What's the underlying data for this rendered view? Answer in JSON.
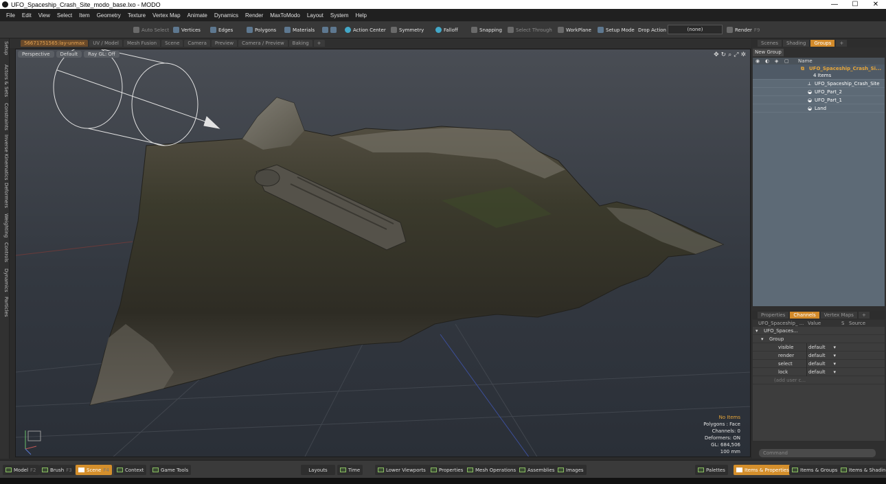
{
  "window": {
    "title": "UFO_Spaceship_Crash_Site_modo_base.lxo - MODO",
    "min": "—",
    "max": "☐",
    "close": "✕"
  },
  "menu": [
    "File",
    "Edit",
    "View",
    "Select",
    "Item",
    "Geometry",
    "Texture",
    "Vertex Map",
    "Animate",
    "Dynamics",
    "Render",
    "MaxToModo",
    "Layout",
    "System",
    "Help"
  ],
  "toolbar": {
    "auto_select": "Auto Select",
    "vertices": "Vertices",
    "edges": "Edges",
    "polygons": "Polygons",
    "materials": "Materials",
    "action_center": "Action Center",
    "symmetry": "Symmetry",
    "falloff": "Falloff",
    "snapping": "Snapping",
    "select_through": "Select Through",
    "workplane": "WorkPlane",
    "setup_mode": "Setup Mode",
    "drop_action": "Drop Action",
    "drop_value": "(none)",
    "render": "Render",
    "render_key": "F9"
  },
  "left_tabs": [
    "Setup",
    "Actors & Sets",
    "Constraints",
    "Inverse Kinematics",
    "Deformers",
    "Weighting",
    "Controls",
    "Dynamics",
    "Particles"
  ],
  "viewport_tabs": [
    "56671751565:lay-unmax",
    "UV / Model",
    "Mesh Fusion",
    "Scene",
    "Camera",
    "Preview",
    "Camera / Preview",
    "Baking",
    "+"
  ],
  "viewport": {
    "view": "Perspective",
    "shading": "Default",
    "raygl": "Ray GL: Off",
    "info": {
      "items": "No Items",
      "polygons": "Polygons : Face",
      "channels": "Channels: 0",
      "deformers": "Deformers: ON",
      "gl": "GL: 684,506",
      "scale": "100 mm"
    }
  },
  "scene_tabs": [
    "Scenes",
    "Shading",
    "Groups",
    "+"
  ],
  "groups": {
    "new_group": "New Group",
    "name_header": "Name",
    "root": {
      "name": "UFO_Spaceship_Crash_Si...",
      "count": "4 Items"
    },
    "children": [
      "UFO_Spaceship_Crash_Site",
      "UFO_Part_2",
      "UFO_Part_1",
      "Land"
    ]
  },
  "prop_tabs": [
    "Properties",
    "Channels",
    "Vertex Maps",
    "+"
  ],
  "channels": {
    "headers": {
      "name": "UFO_Spaceship_ ...",
      "value": "Value",
      "s": "S",
      "source": "Source"
    },
    "item": "UFO_Spaces...",
    "group": "Group",
    "rows": [
      {
        "name": "visible",
        "value": "default"
      },
      {
        "name": "render",
        "value": "default"
      },
      {
        "name": "select",
        "value": "default"
      },
      {
        "name": "lock",
        "value": "default"
      }
    ],
    "add_user": "(add user c..."
  },
  "command_placeholder": "Command",
  "bottom": {
    "model": "Model",
    "model_key": "F2",
    "brush": "Brush",
    "brush_key": "F3",
    "scene": "Scene",
    "scene_key": "F4",
    "context": "Context",
    "game_tools": "Game Tools",
    "layouts": "Layouts",
    "time": "Time",
    "lower_viewports": "Lower Viewports",
    "properties": "Properties",
    "mesh_operations": "Mesh Operations",
    "assemblies": "Assemblies",
    "images": "Images",
    "palettes": "Palettes",
    "items_properties": "Items & Properties",
    "items_groups": "Items & Groups",
    "items_shading": "Items & Shading"
  },
  "colors": {
    "accent": "#d48f2c",
    "viewport_top": "#494d54",
    "groups_bg": "#5d6a76"
  }
}
